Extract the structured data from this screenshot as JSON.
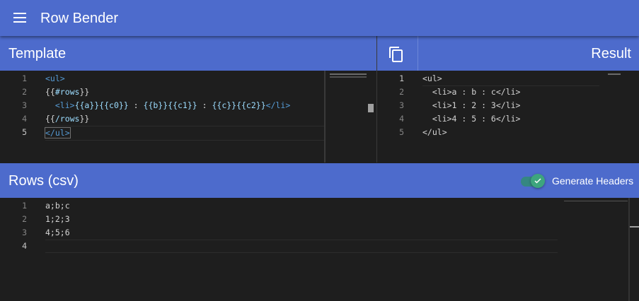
{
  "app": {
    "title": "Row Bender"
  },
  "template_panel": {
    "title": "Template",
    "line_numbers": [
      "1",
      "2",
      "3",
      "4",
      "5"
    ],
    "lines": [
      {
        "l1": "<ul>"
      },
      {
        "a": "{{",
        "b": "#rows",
        "c": "}}"
      },
      {
        "indent": "  ",
        "t1": "<li>",
        "m1": "{{a}}{{c0}}",
        "s1": " : ",
        "m2": "{{b}}{{c1}}",
        "s2": " : ",
        "m3": "{{c}}{{c2}}",
        "t2": "</li>"
      },
      {
        "a": "{{",
        "b": "/rows",
        "c": "}}"
      },
      {
        "l1": "</ul>"
      }
    ]
  },
  "result_panel": {
    "title": "Result",
    "copy_icon": "copy-icon",
    "line_numbers": [
      "1",
      "2",
      "3",
      "4",
      "5"
    ],
    "lines": [
      "<ul>",
      "  <li>a : b : c</li>",
      "  <li>1 : 2 : 3</li>",
      "  <li>4 : 5 : 6</li>",
      "</ul>"
    ]
  },
  "rows_panel": {
    "title": "Rows (csv)",
    "toggle_label": "Generate Headers",
    "toggle_checked": true,
    "line_numbers": [
      "1",
      "2",
      "3",
      "4"
    ],
    "lines": [
      "a;b;c",
      "1;2;3",
      "4;5;6",
      ""
    ]
  },
  "colors": {
    "accent": "#4d6bcc",
    "editor_bg": "#1e1e1e",
    "toggle_on": "#3da57e"
  }
}
